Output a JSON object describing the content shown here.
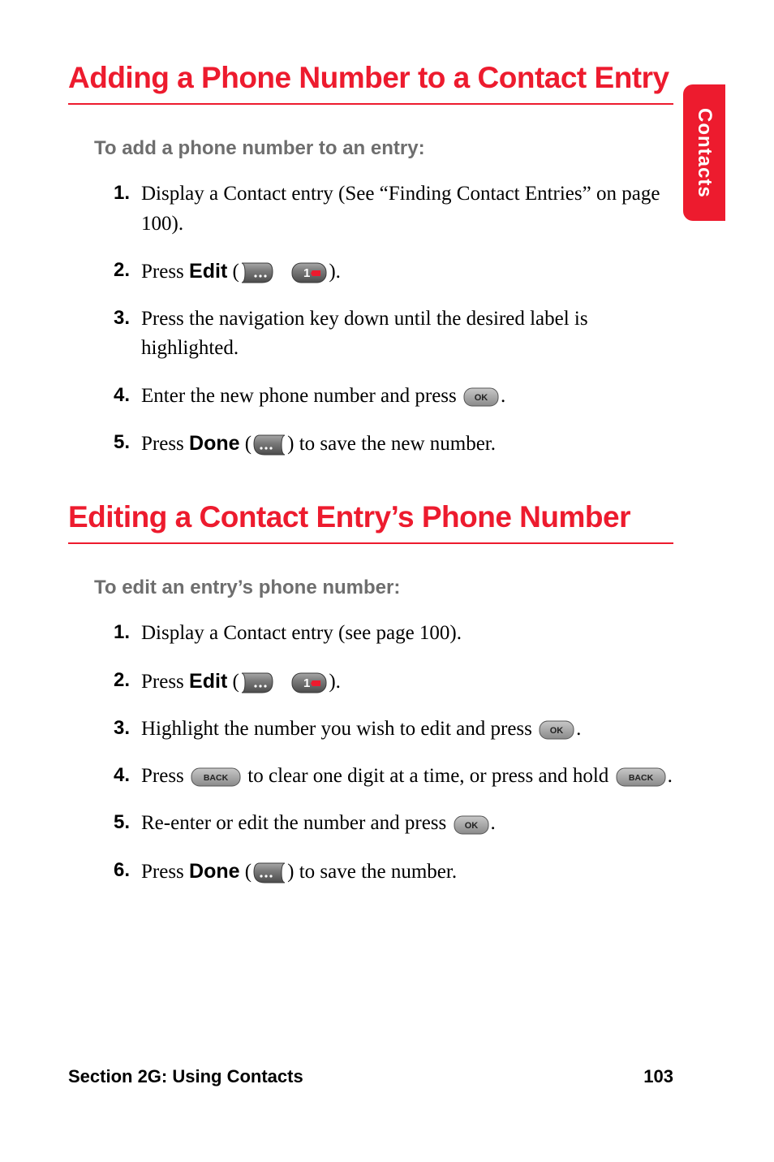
{
  "sideTab": "Contacts",
  "section1": {
    "title": "Adding a Phone Number to a Contact Entry",
    "intro": "To add a phone number to an entry:",
    "steps": {
      "s1": {
        "num": "1.",
        "a": "Display a Contact entry (See “Finding Contact Entries” on page 100)."
      },
      "s2": {
        "num": "2.",
        "a": "Press ",
        "edit": "Edit",
        "b": " (",
        "c": ")."
      },
      "s3": {
        "num": "3.",
        "a": "Press the navigation key down until the desired label is highlighted."
      },
      "s4": {
        "num": "4.",
        "a": "Enter the new phone number and press ",
        "b": "."
      },
      "s5": {
        "num": "5.",
        "a": "Press ",
        "done": "Done",
        "b": " (",
        "c": ") to save the new number."
      }
    }
  },
  "section2": {
    "title": "Editing a Contact Entry’s Phone Number",
    "intro": "To edit an entry’s phone number:",
    "steps": {
      "s1": {
        "num": "1.",
        "a": "Display a Contact entry (see page 100)."
      },
      "s2": {
        "num": "2.",
        "a": "Press ",
        "edit": "Edit",
        "b": " (",
        "c": ")."
      },
      "s3": {
        "num": "3.",
        "a": "Highlight the number you wish to edit and press ",
        "b": "."
      },
      "s4": {
        "num": "4.",
        "a": "Press ",
        "b": " to clear one digit at a time, or press and hold ",
        "c": "."
      },
      "s5": {
        "num": "5.",
        "a": "Re-enter or edit the number and press ",
        "b": "."
      },
      "s6": {
        "num": "6.",
        "a": "Press ",
        "done": "Done",
        "b": " (",
        "c": ") to save the number."
      }
    }
  },
  "footer": {
    "left": "Section 2G: Using Contacts",
    "right": "103"
  }
}
